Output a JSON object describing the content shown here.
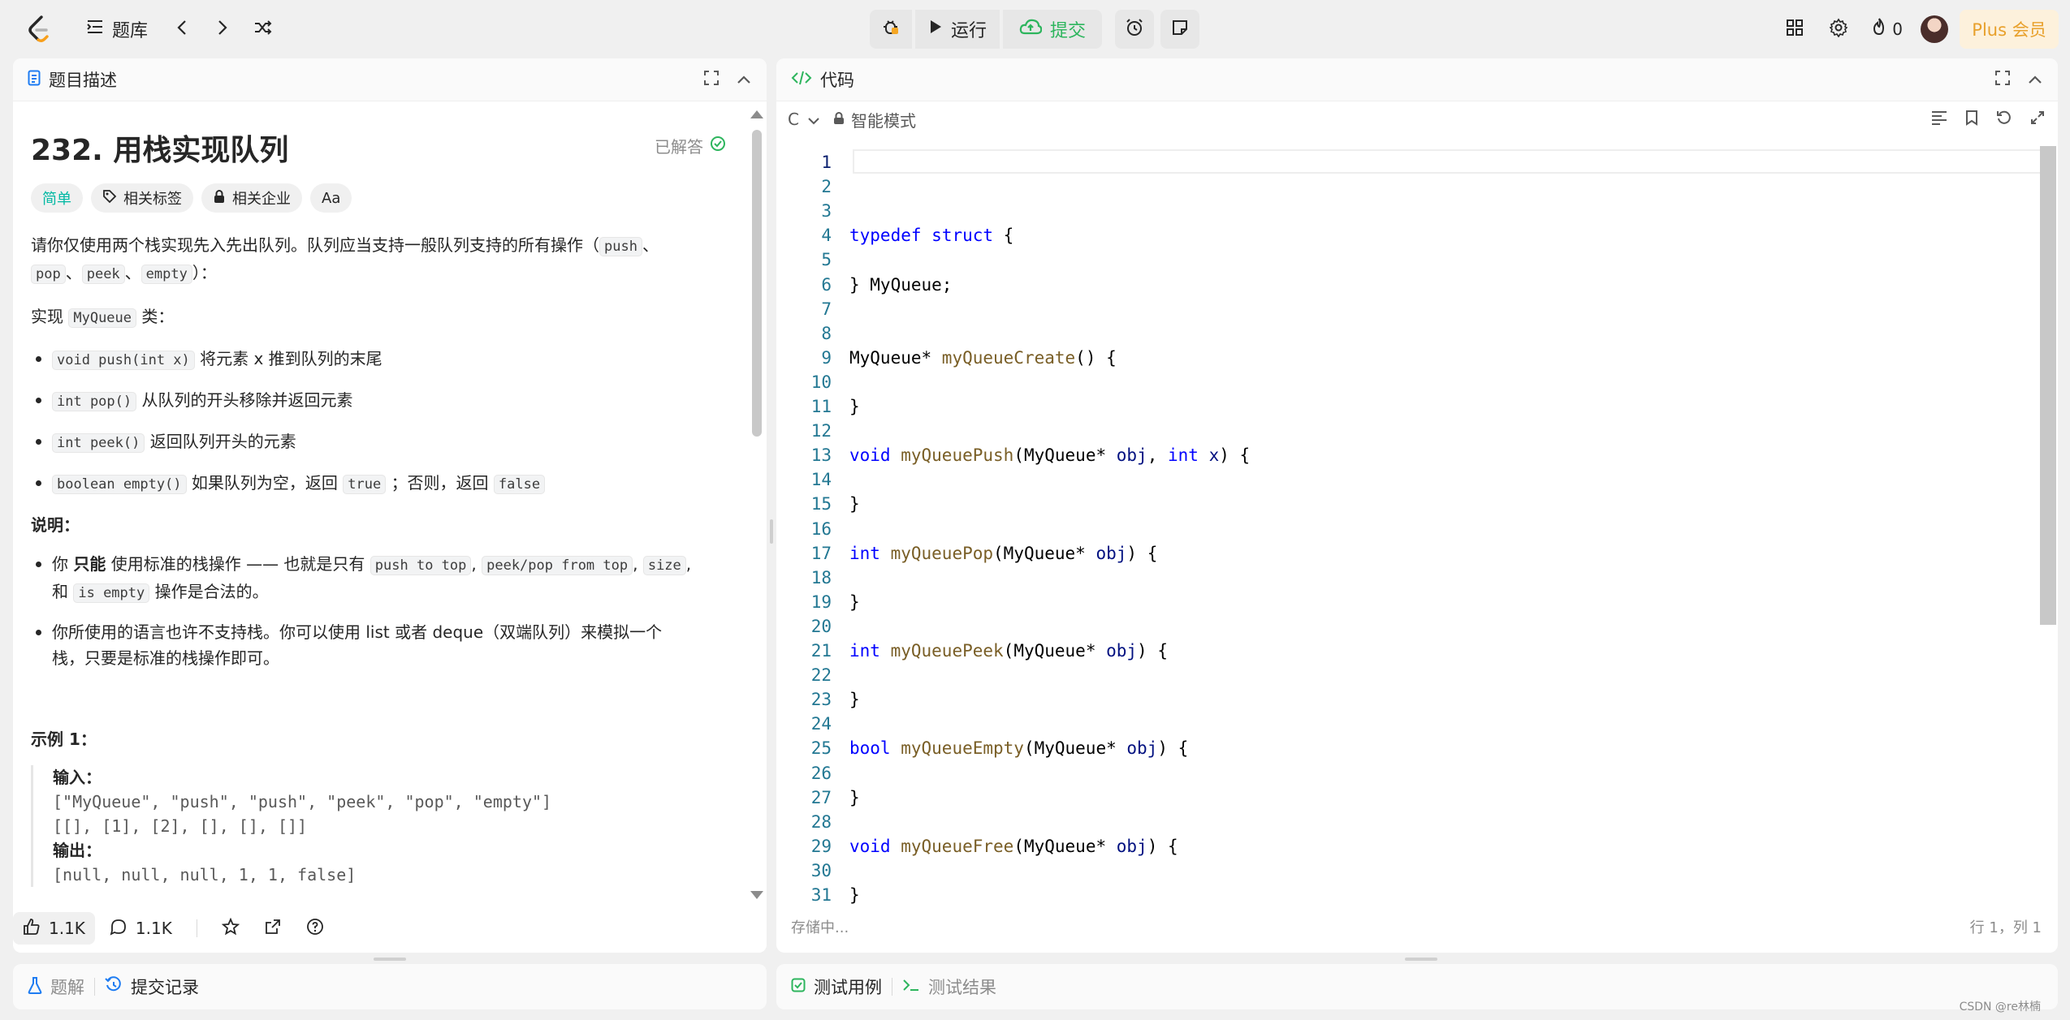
{
  "topbar": {
    "problem_bank_label": "题库",
    "run_label": "运行",
    "submit_label": "提交",
    "streak_count": "0",
    "plus_label": "Plus 会员"
  },
  "description_panel": {
    "tab_label": "题目描述",
    "title": "232. 用栈实现队列",
    "solved_label": "已解答",
    "tags": {
      "difficulty": "简单",
      "related_tags": "相关标签",
      "related_companies": "相关企业",
      "font_toggle": "Aa"
    },
    "intro_a": "请你仅使用两个栈实现先入先出队列。队列应当支持一般队列支持的所有操作（",
    "intro_code_push": "push",
    "intro_sep": "、",
    "intro_code_pop": "pop",
    "intro_code_peek": "peek",
    "intro_code_empty": "empty",
    "intro_end": "）：",
    "impl_a": "实现",
    "impl_code": "MyQueue",
    "impl_b": "类：",
    "methods": [
      {
        "code": "void push(int x)",
        "text": "将元素 x 推到队列的末尾"
      },
      {
        "code": "int pop()",
        "text": "从队列的开头移除并返回元素"
      },
      {
        "code": "int peek()",
        "text": "返回队列开头的元素"
      },
      {
        "code": "boolean empty()",
        "text": "如果队列为空，返回",
        "code2": "true",
        "text2": "；否则，返回",
        "code3": "false"
      }
    ],
    "notes_heading": "说明：",
    "note1": {
      "a": "你",
      "bold": "只能",
      "b": "使用标准的栈操作 —— 也就是只有",
      "c1": "push to top",
      "s1": ",",
      "c2": "peek/pop from top",
      "s2": ",",
      "c3": "size",
      "s3": ",",
      "and": "和",
      "c4": "is empty",
      "end": "操作是合法的。"
    },
    "note2_line1": "你所使用的语言也许不支持栈。你可以使用 list 或者 deque（双端队列）来模拟一个",
    "note2_line2": "栈，只要是标准的栈操作即可。",
    "example_heading": "示例 1：",
    "example": {
      "input_label": "输入：",
      "input_line1": "[\"MyQueue\", \"push\", \"push\", \"peek\", \"pop\", \"empty\"]",
      "input_line2": "[[], [1], [2], [], [], []]",
      "output_label": "输出：",
      "output_line1": "[null, null, null, 1, 1, false]"
    },
    "footer": {
      "likes": "1.1K",
      "comments": "1.1K"
    }
  },
  "code_panel": {
    "tab_label": "代码",
    "language": "C",
    "mode_label": "智能模式",
    "status_left": "存储中...",
    "status_right": "行 1，列 1",
    "lines": [
      {
        "n": "1",
        "tokens": []
      },
      {
        "n": "2",
        "tokens": []
      },
      {
        "n": "3",
        "tokens": []
      },
      {
        "n": "4",
        "tokens": [
          {
            "t": "typedef",
            "c": "kw"
          },
          {
            "t": " "
          },
          {
            "t": "struct",
            "c": "kw"
          },
          {
            "t": " {"
          }
        ]
      },
      {
        "n": "5",
        "tokens": []
      },
      {
        "n": "6",
        "tokens": [
          {
            "t": "} MyQueue;"
          }
        ]
      },
      {
        "n": "7",
        "tokens": []
      },
      {
        "n": "8",
        "tokens": []
      },
      {
        "n": "9",
        "tokens": [
          {
            "t": "MyQueue* "
          },
          {
            "t": "myQueueCreate",
            "c": "fn"
          },
          {
            "t": "() {"
          }
        ]
      },
      {
        "n": "10",
        "tokens": []
      },
      {
        "n": "11",
        "tokens": [
          {
            "t": "}"
          }
        ]
      },
      {
        "n": "12",
        "tokens": []
      },
      {
        "n": "13",
        "tokens": [
          {
            "t": "void",
            "c": "kw"
          },
          {
            "t": " "
          },
          {
            "t": "myQueuePush",
            "c": "fn"
          },
          {
            "t": "(MyQueue* "
          },
          {
            "t": "obj",
            "c": "vr"
          },
          {
            "t": ", "
          },
          {
            "t": "int",
            "c": "kw"
          },
          {
            "t": " "
          },
          {
            "t": "x",
            "c": "vr"
          },
          {
            "t": ") {"
          }
        ]
      },
      {
        "n": "14",
        "tokens": []
      },
      {
        "n": "15",
        "tokens": [
          {
            "t": "}"
          }
        ]
      },
      {
        "n": "16",
        "tokens": []
      },
      {
        "n": "17",
        "tokens": [
          {
            "t": "int",
            "c": "kw"
          },
          {
            "t": " "
          },
          {
            "t": "myQueuePop",
            "c": "fn"
          },
          {
            "t": "(MyQueue* "
          },
          {
            "t": "obj",
            "c": "vr"
          },
          {
            "t": ") {"
          }
        ]
      },
      {
        "n": "18",
        "tokens": []
      },
      {
        "n": "19",
        "tokens": [
          {
            "t": "}"
          }
        ]
      },
      {
        "n": "20",
        "tokens": []
      },
      {
        "n": "21",
        "tokens": [
          {
            "t": "int",
            "c": "kw"
          },
          {
            "t": " "
          },
          {
            "t": "myQueuePeek",
            "c": "fn"
          },
          {
            "t": "(MyQueue* "
          },
          {
            "t": "obj",
            "c": "vr"
          },
          {
            "t": ") {"
          }
        ]
      },
      {
        "n": "22",
        "tokens": []
      },
      {
        "n": "23",
        "tokens": [
          {
            "t": "}"
          }
        ]
      },
      {
        "n": "24",
        "tokens": []
      },
      {
        "n": "25",
        "tokens": [
          {
            "t": "bool",
            "c": "kw"
          },
          {
            "t": " "
          },
          {
            "t": "myQueueEmpty",
            "c": "fn"
          },
          {
            "t": "(MyQueue* "
          },
          {
            "t": "obj",
            "c": "vr"
          },
          {
            "t": ") {"
          }
        ]
      },
      {
        "n": "26",
        "tokens": []
      },
      {
        "n": "27",
        "tokens": [
          {
            "t": "}"
          }
        ]
      },
      {
        "n": "28",
        "tokens": []
      },
      {
        "n": "29",
        "tokens": [
          {
            "t": "void",
            "c": "kw"
          },
          {
            "t": " "
          },
          {
            "t": "myQueueFree",
            "c": "fn"
          },
          {
            "t": "(MyQueue* "
          },
          {
            "t": "obj",
            "c": "vr"
          },
          {
            "t": ") {"
          }
        ]
      },
      {
        "n": "30",
        "tokens": []
      },
      {
        "n": "31",
        "tokens": [
          {
            "t": "}"
          }
        ]
      }
    ]
  },
  "bottom_left": {
    "solutions_label": "题解",
    "submissions_label": "提交记录"
  },
  "bottom_right": {
    "testcase_label": "测试用例",
    "result_label": "测试结果"
  },
  "watermark": "CSDN @re林楠",
  "colors": {
    "accent_green": "#2db55d",
    "easy_teal": "#00b8a3",
    "plus_orange": "#e8a02b",
    "keyword_blue": "#0000ff",
    "function_brown": "#795e26"
  }
}
